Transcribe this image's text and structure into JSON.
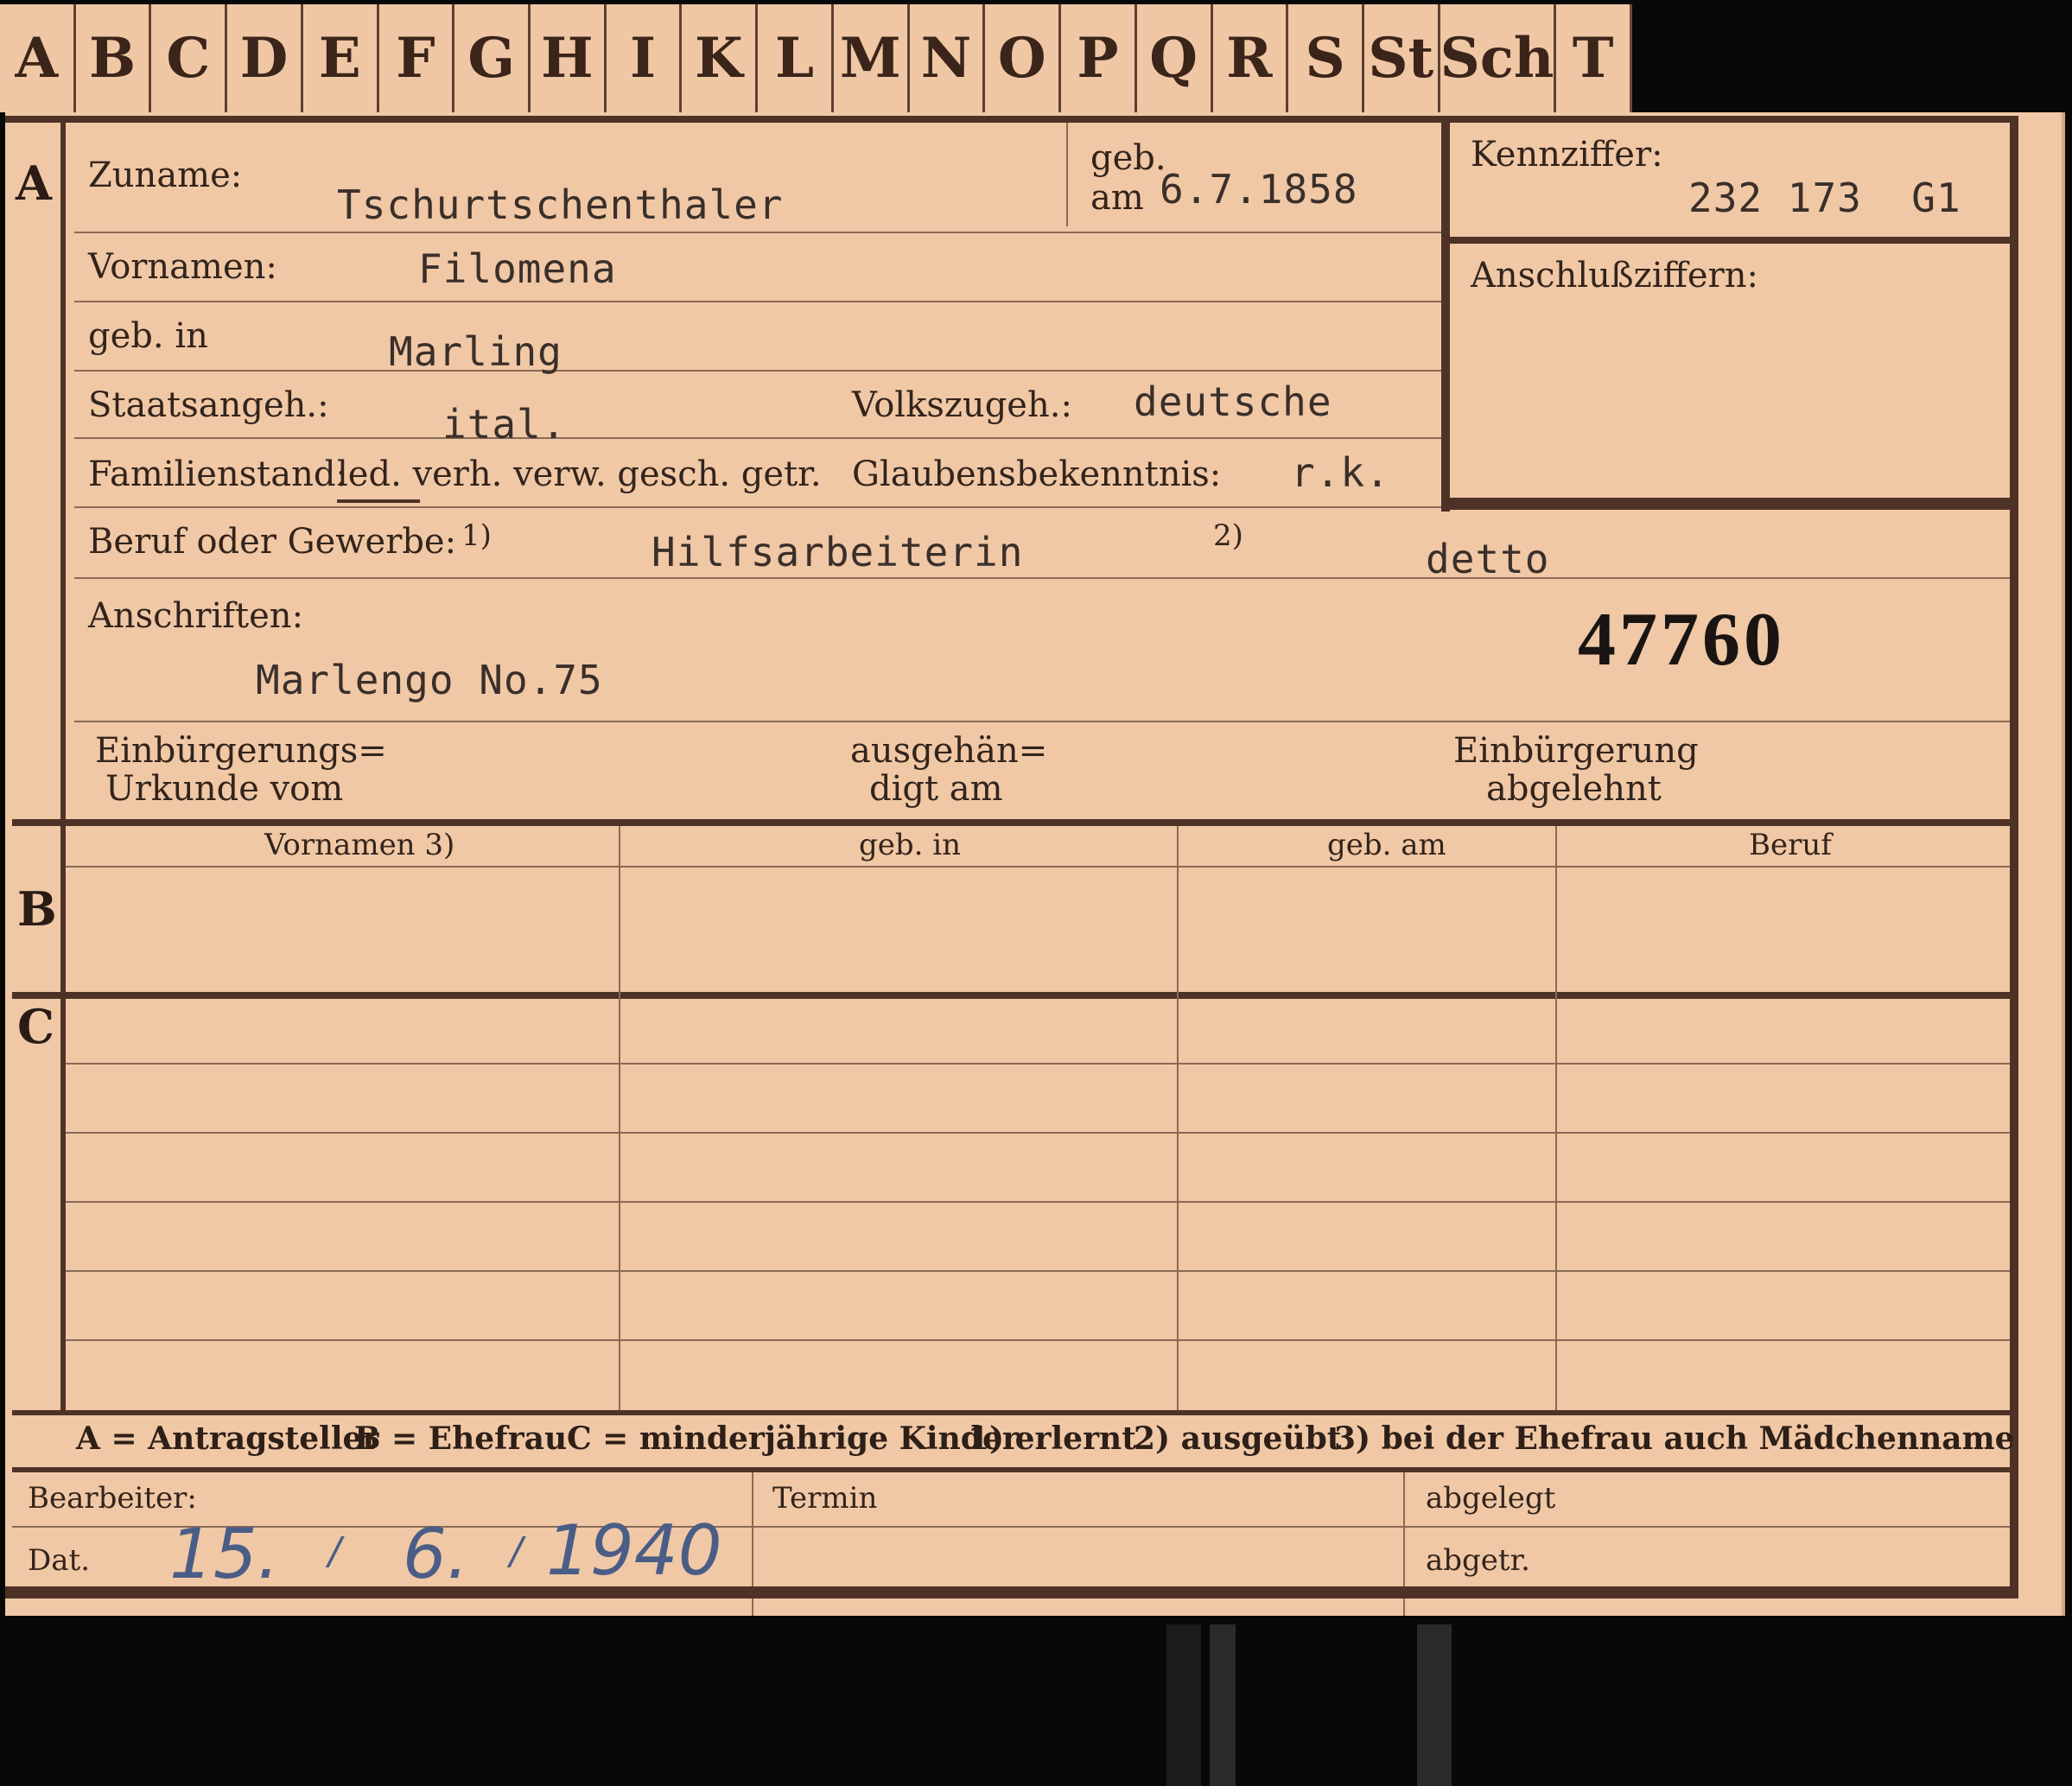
{
  "index_tabs": [
    "A",
    "B",
    "C",
    "D",
    "E",
    "F",
    "G",
    "H",
    "I",
    "K",
    "L",
    "M",
    "N",
    "O",
    "P",
    "Q",
    "R",
    "S",
    "St",
    "Sch",
    "T"
  ],
  "section_A": {
    "letter": "A",
    "zuname_label": "Zuname:",
    "zuname_value": "Tschurtschenthaler",
    "geb_label": "geb.",
    "am_label": "am",
    "geb_am_value": "6.7.1858",
    "kennziffer_label": "Kennziffer:",
    "kennziffer_value": "232 173  G1",
    "anschluss_label": "Anschlußziffern:",
    "vornamen_label": "Vornamen:",
    "vornamen_value": "Filomena",
    "geb_in_label": "geb. in",
    "geb_in_value": "Marling",
    "staatsangeh_label": "Staatsangeh.:",
    "staatsangeh_value": "ital.",
    "volkszugeh_label": "Volkszugeh.:",
    "volkszugeh_value": "deutsche",
    "familienstand_label": "Familienstand:",
    "familienstand_options": "led. verh. verw. gesch. getr.",
    "glauben_label": "Glaubensbekenntnis:",
    "glauben_value": "r.k.",
    "beruf_label": "Beruf oder Gewerbe:",
    "fn1": "1)",
    "beruf_value": "Hilfsarbeiterin",
    "fn2": "2)",
    "beruf_value_2": "detto",
    "anschriften_label": "Anschriften:",
    "anschriften_value": "Marlengo No.75",
    "file_number": "47760",
    "einb_urkunde_l1": "Einbürgerungs=",
    "einb_urkunde_l2": "Urkunde vom",
    "ausgeh_l1": "ausgehän=",
    "ausgeh_l2": "digt am",
    "einb_abgelehnt_l1": "Einbürgerung",
    "einb_abgelehnt_l2": "abgelehnt"
  },
  "section_B": {
    "letter": "B",
    "col_vornamen": "Vornamen 3)",
    "col_geb_in": "geb. in",
    "col_geb_am": "geb. am",
    "col_beruf": "Beruf"
  },
  "section_C": {
    "letter": "C"
  },
  "legend": {
    "a": "A = Antragsteller",
    "b": "B = Ehefrau",
    "c": "C = minderjährige Kinder",
    "n1": "1) erlernt",
    "n2": "2) ausgeübt",
    "n3": "3) bei der Ehefrau auch Mädchenname"
  },
  "footer": {
    "bearbeiter_label": "Bearbeiter:",
    "dat_label": "Dat.",
    "date_day": "15.",
    "date_month": "6.",
    "date_year": "1940",
    "termin_label": "Termin",
    "abgelegt_label": "abgelegt",
    "abgetr_label": "abgetr."
  }
}
